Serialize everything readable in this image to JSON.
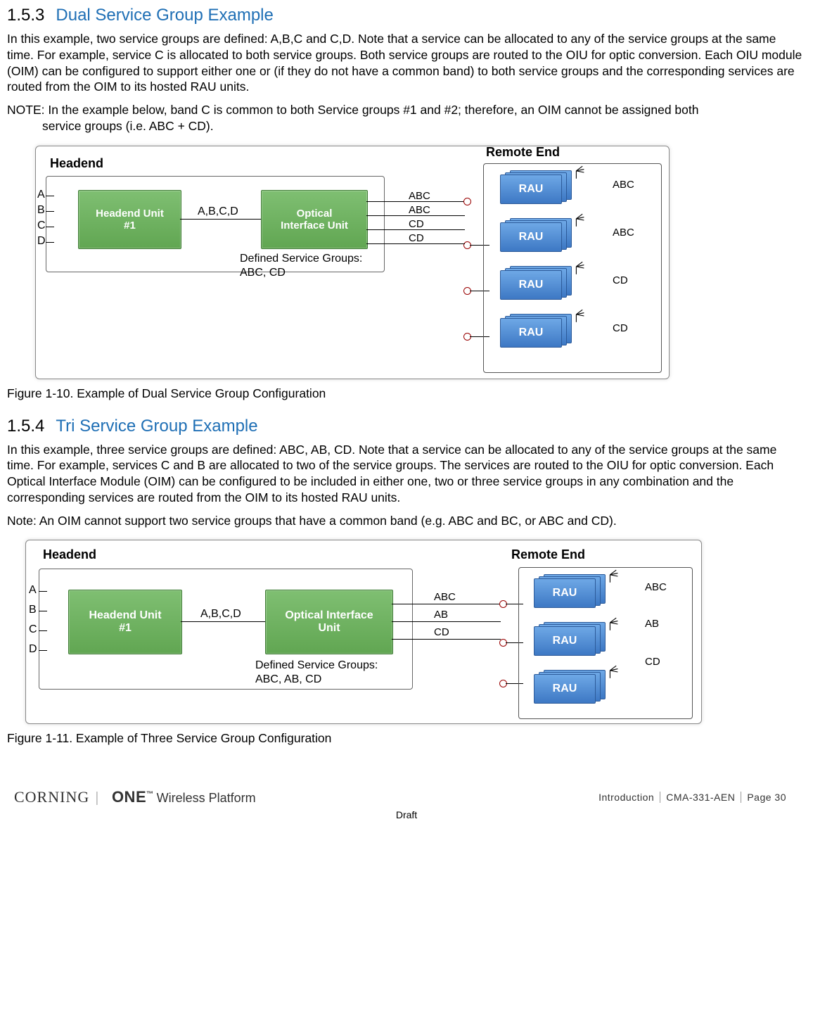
{
  "section1": {
    "num": "1.5.3",
    "title": "Dual Service Group Example",
    "para": "In this example, two service groups are defined: A,B,C and C,D. Note that a service can be allocated to any of the service groups at the same time. For example, service C is allocated to both service groups. Both service groups are routed to the OIU for optic conversion. Each OIU module (OIM) can be configured to support either one or (if they do not have a common band) to both service groups and the corresponding services are routed from the OIM to its hosted RAU units.",
    "note_l1": "NOTE: In the example below, band C is common to both Service groups #1 and #2; therefore, an OIM cannot be assigned both",
    "note_l2": "service groups (i.e. ABC + CD).",
    "figcap": "Figure 1-10. Example of Dual Service Group Configuration"
  },
  "dia1": {
    "headend": "Headend",
    "remote": "Remote End",
    "inputs": {
      "a": "A",
      "b": "B",
      "c": "C",
      "d": "D"
    },
    "hu": "Headend Unit\n#1",
    "link": "A,B,C,D",
    "oiu": "Optical\nInterface Unit",
    "defined": "Defined Service Groups:\nABC, CD",
    "out": {
      "o1": "ABC",
      "o2": "ABC",
      "o3": "CD",
      "o4": "CD"
    },
    "rau": "RAU",
    "rlabels": {
      "r1": "ABC",
      "r2": "ABC",
      "r3": "CD",
      "r4": "CD"
    }
  },
  "section2": {
    "num": "1.5.4",
    "title": "Tri Service Group Example",
    "para": "In this example, three service groups are defined: ABC, AB, CD. Note that a service can be allocated to any of the service groups at the same time. For example, services C and B are allocated to two of the service groups. The services are routed to the OIU for optic conversion. Each Optical Interface Module (OIM) can be configured to be included in either one, two or three service groups in any combination and the corresponding services are routed from the OIM to its hosted RAU units.",
    "note": "Note: An OIM cannot support two service groups that have a common band (e.g. ABC and BC, or ABC and CD).",
    "figcap": "Figure 1-11. Example of Three Service Group Configuration"
  },
  "dia2": {
    "headend": "Headend",
    "remote": "Remote End",
    "inputs": {
      "a": "A",
      "b": "B",
      "c": "C",
      "d": "D"
    },
    "hu": "Headend Unit\n#1",
    "link": "A,B,C,D",
    "oiu": "Optical Interface\nUnit",
    "defined": "Defined Service Groups:\nABC, AB, CD",
    "out": {
      "o1": "ABC",
      "o2": "AB",
      "o3": "CD"
    },
    "rau": "RAU",
    "rlabels": {
      "r1": "ABC",
      "r2": "AB",
      "r3": "CD"
    }
  },
  "footer": {
    "brand1": "CORNING",
    "brand2": "ONE",
    "brand3": "Wireless Platform",
    "f1": "Introduction",
    "f2": "CMA-331-AEN",
    "f3": "Page 30",
    "draft": "Draft"
  }
}
